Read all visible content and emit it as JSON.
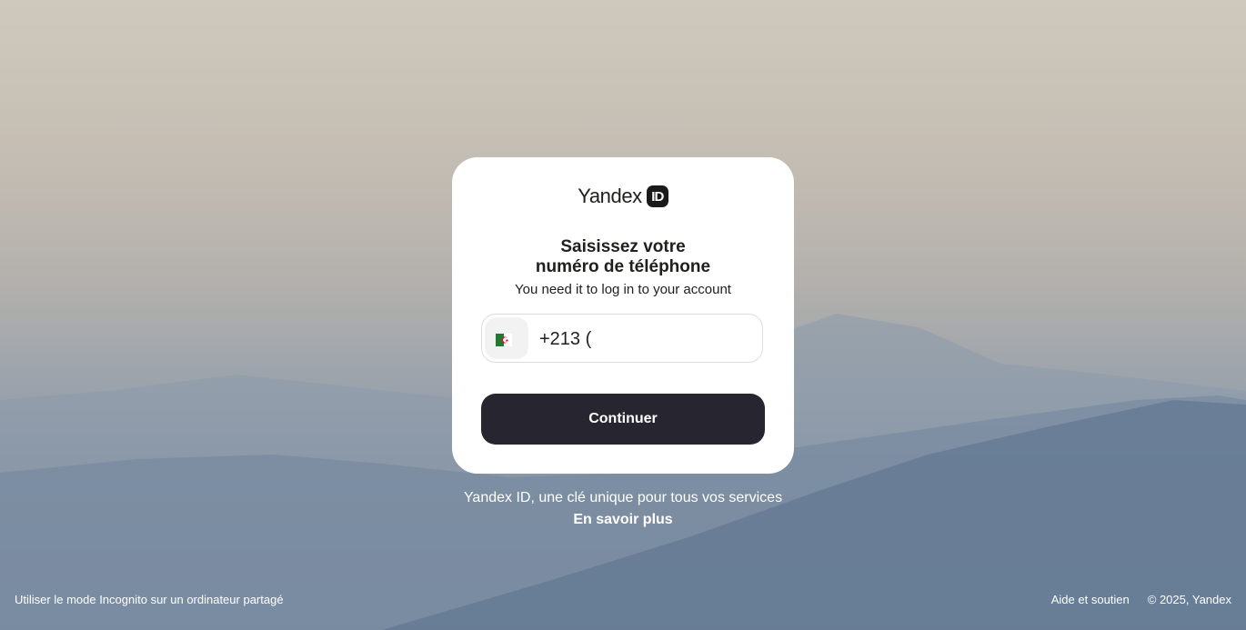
{
  "logo": {
    "text": "Yandex",
    "badge": "ID"
  },
  "form": {
    "title_line1": "Saisissez votre",
    "title_line2": "numéro de téléphone",
    "subtitle": "You need it to log in to your account",
    "country_flag": "algeria-flag-icon",
    "phone_value": "+213 (",
    "continue_label": "Continuer"
  },
  "promo": {
    "text": "Yandex ID, une clé unique pour tous vos services",
    "link": "En savoir plus"
  },
  "footer": {
    "incognito_hint": "Utiliser le mode Incognito sur un ordinateur partagé",
    "help_link": "Aide et soutien",
    "copyright": "© 2025, Yandex"
  },
  "colors": {
    "button_bg": "#272630",
    "card_bg": "#ffffff",
    "flag_green": "#1e7b2f",
    "flag_red": "#d21034"
  }
}
